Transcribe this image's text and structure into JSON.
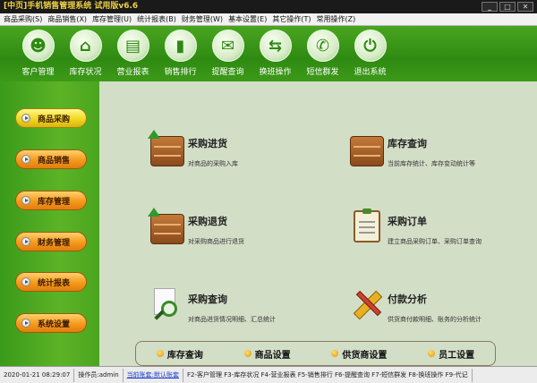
{
  "window": {
    "title": "[中页]手机销售管理系统 试用版v6.6",
    "buttons": [
      "_",
      "□",
      "✕"
    ]
  },
  "menu": [
    "商品采购(S)",
    "商品销售(X)",
    "库存管理(U)",
    "统计报表(B)",
    "财务管理(W)",
    "基本设置(E)",
    "其它操作(T)",
    "常用操作(Z)"
  ],
  "toolbar": [
    {
      "label": "客户管理",
      "icon": "person-card-icon",
      "glyph": "☻"
    },
    {
      "label": "库存状况",
      "icon": "house-icon",
      "glyph": "⌂"
    },
    {
      "label": "营业报表",
      "icon": "clipboard-icon",
      "glyph": "▤"
    },
    {
      "label": "销售排行",
      "icon": "bar-chart-icon",
      "glyph": "▮"
    },
    {
      "label": "提醒查询",
      "icon": "message-icon",
      "glyph": "✉"
    },
    {
      "label": "换班操作",
      "icon": "swap-icon",
      "glyph": "⇆"
    },
    {
      "label": "短信群发",
      "icon": "sms-icon",
      "glyph": "✆"
    },
    {
      "label": "退出系统",
      "icon": "power-icon",
      "glyph": "⏻"
    }
  ],
  "sidebar": [
    {
      "label": "商品采购",
      "style": "yellow"
    },
    {
      "label": "商品销售",
      "style": "orange"
    },
    {
      "label": "库存管理",
      "style": "orange"
    },
    {
      "label": "财务管理",
      "style": "orange"
    },
    {
      "label": "统计报表",
      "style": "orange"
    },
    {
      "label": "系统设置",
      "style": "orange"
    }
  ],
  "features": [
    {
      "title": "采购进货",
      "desc": "对商品的采购入库",
      "icon": "box-in-icon"
    },
    {
      "title": "库存查询",
      "desc": "当前库存统计、库存变动统计等",
      "icon": "box-icon"
    },
    {
      "title": "采购退货",
      "desc": "对采购商品进行退货",
      "icon": "box-return-icon"
    },
    {
      "title": "采购订单",
      "desc": "建立商品采购订单、采购订单查询",
      "icon": "clipboard-order-icon"
    },
    {
      "title": "采购查询",
      "desc": "对商品进货情况明细、汇总统计",
      "icon": "magnifier-icon"
    },
    {
      "title": "付款分析",
      "desc": "供货商付款明细、账务的分析统计",
      "icon": "ruler-pencil-icon"
    }
  ],
  "quicklinks": [
    "库存查询",
    "商品设置",
    "供货商设置",
    "员工设置"
  ],
  "status": {
    "datetime": "2020-01-21 08:29:07",
    "operator": "操作员:admin",
    "account": "当前账套:默认账套",
    "shortcuts": "F2-客户管理 F3-库存状况 F4-营业报表 F5-销售排行 F6-提醒查询 F7-短信群发 F8-换班操作 F9-代记"
  },
  "colors": {
    "toolbar_green": "#3d9a18",
    "sidebar_yellow": "#f2d820",
    "sidebar_orange": "#f59a1a",
    "content_bg": "#d3dec7"
  }
}
